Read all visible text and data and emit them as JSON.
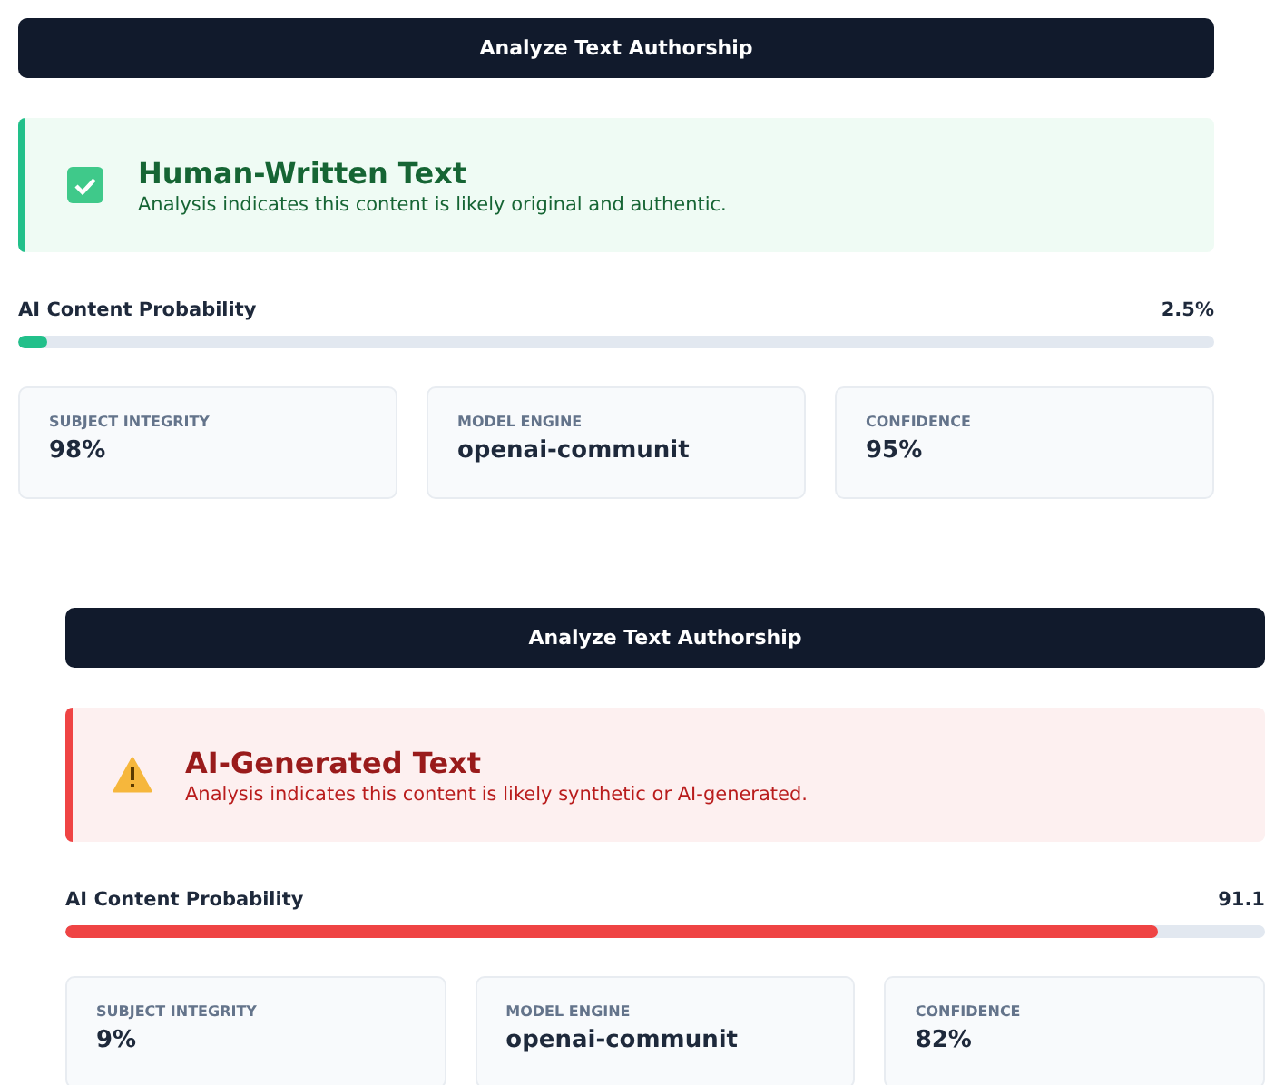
{
  "panels": [
    {
      "button": "Analyze Text Authorship",
      "verdict": {
        "kind": "human",
        "title": "Human-Written Text",
        "message": "Analysis indicates this content is likely original and authentic."
      },
      "probability": {
        "label": "AI Content Probability",
        "reading": "2.5%",
        "level": 0.025
      },
      "stats": [
        {
          "label": "SUBJECT INTEGRITY",
          "value": "98%"
        },
        {
          "label": "MODEL ENGINE",
          "value": "openai-communit"
        },
        {
          "label": "CONFIDENCE",
          "value": "95%"
        }
      ]
    },
    {
      "button": "Analyze Text Authorship",
      "verdict": {
        "kind": "ai",
        "title": "AI-Generated Text",
        "message": "Analysis indicates this content is likely synthetic or AI-generated."
      },
      "probability": {
        "label": "AI Content Probability",
        "reading": "91.1",
        "level": 0.911
      },
      "stats": [
        {
          "label": "SUBJECT INTEGRITY",
          "value": "9%"
        },
        {
          "label": "MODEL ENGINE",
          "value": "openai-communit"
        },
        {
          "label": "CONFIDENCE",
          "value": "82%"
        }
      ]
    }
  ]
}
